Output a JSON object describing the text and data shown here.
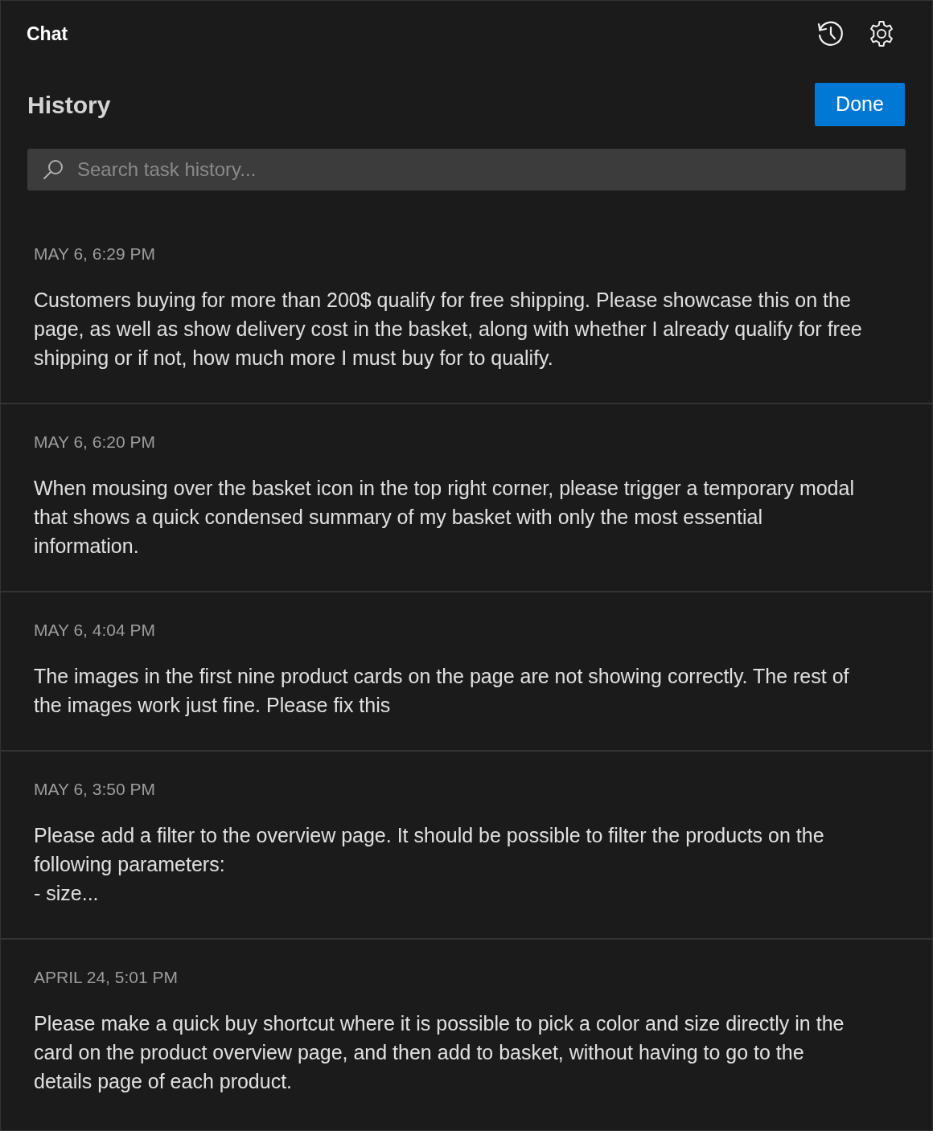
{
  "header": {
    "title": "Chat"
  },
  "history": {
    "title": "History",
    "done_button": "Done",
    "search": {
      "placeholder": "Search task history..."
    },
    "items": [
      {
        "date": "MAY 6, 6:29 PM",
        "text": "Customers buying for more than 200$ qualify for free shipping. Please showcase this on the page, as well as show delivery cost in the basket, along with whether I already qualify for free shipping or if not, how much more I must buy for to qualify."
      },
      {
        "date": "MAY 6, 6:20 PM",
        "text": "When mousing over the basket icon in the top right corner, please trigger a temporary modal that shows a quick condensed summary of my basket with only the most essential information."
      },
      {
        "date": "MAY 6, 4:04 PM",
        "text": "The images in the first nine product cards on the page are not showing correctly. The rest of the images work just fine. Please fix this"
      },
      {
        "date": "MAY 6, 3:50 PM",
        "text": "Please add a filter to the overview page. It should be possible to filter the products on the following parameters:\n- size..."
      },
      {
        "date": "APRIL 24, 5:01 PM",
        "text": "Please make a quick buy shortcut where it is possible to pick a color and size directly in the card on the product overview page, and then add to basket, without having to go to the details page of each product."
      }
    ]
  }
}
